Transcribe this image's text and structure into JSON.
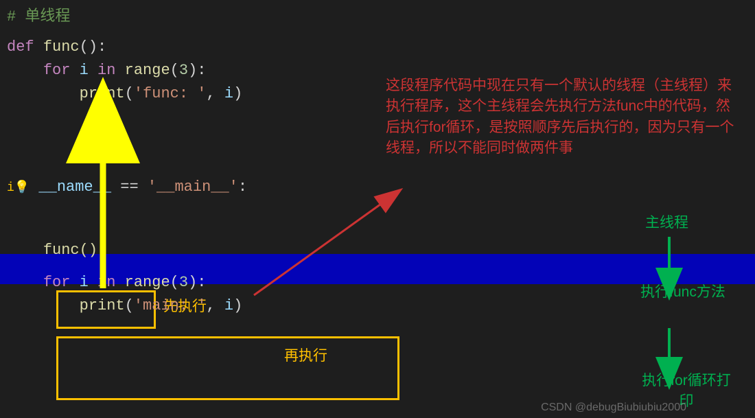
{
  "code": {
    "comment": "# 单线程",
    "l2_def": "def",
    "l2_fn": "func",
    "l2_tail": "():",
    "l3_for": "for",
    "l3_var": "i",
    "l3_in": "in",
    "l3_range": "range",
    "l3_num": "3",
    "l3_tail": "):",
    "l4_print": "print",
    "l4_str": "'func: '",
    "l4_var": "i",
    "l7_if": "if",
    "l7_name": "__name__",
    "l7_eq": " == ",
    "l7_main": "'__main__'",
    "l7_colon": ":",
    "l8_call": "func()",
    "l9_for": "for",
    "l9_var": "i",
    "l9_in": "in",
    "l9_range": "range",
    "l9_num": "3",
    "l9_tail": "):",
    "l10_print": "print",
    "l10_str": "'main: '",
    "l10_var": "i"
  },
  "annot": {
    "red_block": "这段程序代码中现在只有一个默认的线程（主线程）来执行程序，这个主线程会先执行方法func中的代码，然后执行for循环，是按照顺序先后执行的，因为只有一个线程，所以不能同时做两件事",
    "first": "先执行",
    "second": "再执行",
    "g1": "主线程",
    "g2": "执行func方法",
    "g3": "执行for循环打印"
  },
  "watermark": "CSDN @debugBiubiubiu2000"
}
